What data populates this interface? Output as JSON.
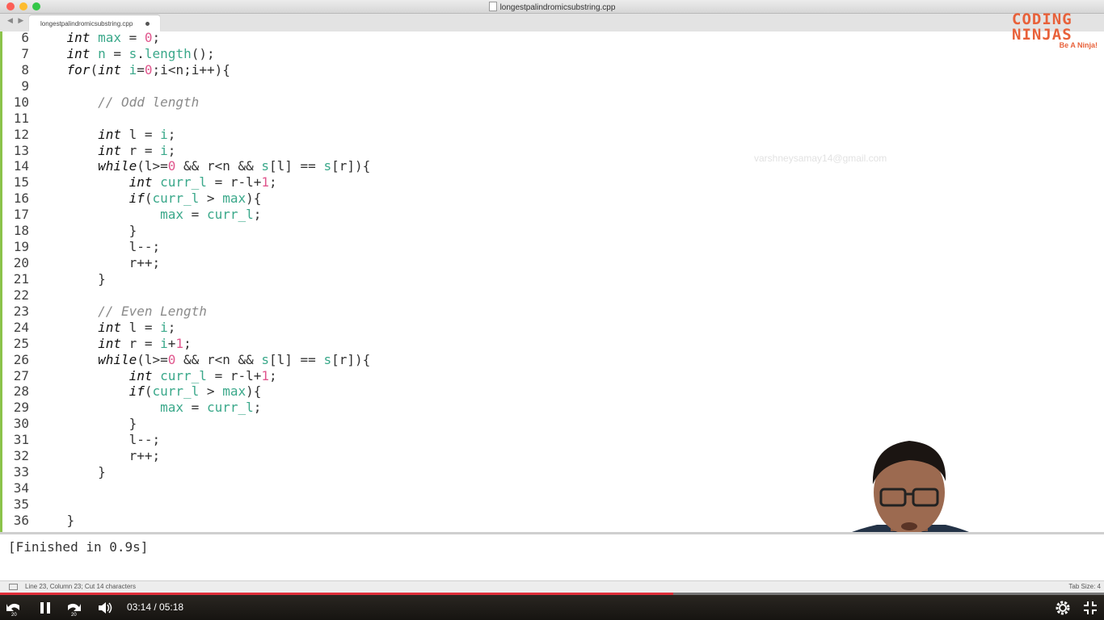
{
  "window": {
    "title": "longestpalindromicsubstring.cpp"
  },
  "tab": {
    "label": "longestpalindromicsubstring.cpp",
    "modified": true
  },
  "brand": {
    "line1": "CODING",
    "line2": "NINJAS",
    "tagline": "Be A Ninja!",
    "accent": "#e8613a"
  },
  "watermark": "varshneysamay14@gmail.com",
  "code": [
    {
      "ln": "6",
      "indent": "    ",
      "tokens": [
        [
          "kw",
          "int"
        ],
        [
          "p",
          " "
        ],
        [
          "v",
          "max"
        ],
        [
          "p",
          " = "
        ],
        [
          "n",
          "0"
        ],
        [
          "p",
          ";"
        ]
      ]
    },
    {
      "ln": "7",
      "indent": "    ",
      "tokens": [
        [
          "kw",
          "int"
        ],
        [
          "p",
          " "
        ],
        [
          "v",
          "n"
        ],
        [
          "p",
          " = "
        ],
        [
          "v",
          "s"
        ],
        [
          "p",
          "."
        ],
        [
          "v",
          "length"
        ],
        [
          "p",
          "();"
        ]
      ]
    },
    {
      "ln": "8",
      "indent": "    ",
      "tokens": [
        [
          "kw",
          "for"
        ],
        [
          "p",
          "("
        ],
        [
          "kw",
          "int"
        ],
        [
          "p",
          " "
        ],
        [
          "v",
          "i"
        ],
        [
          "p",
          "="
        ],
        [
          "n",
          "0"
        ],
        [
          "p",
          ";i<n;i++){"
        ]
      ]
    },
    {
      "ln": "9",
      "indent": "",
      "tokens": []
    },
    {
      "ln": "10",
      "indent": "        ",
      "tokens": [
        [
          "c",
          "// Odd length"
        ]
      ]
    },
    {
      "ln": "11",
      "indent": "",
      "tokens": []
    },
    {
      "ln": "12",
      "indent": "        ",
      "tokens": [
        [
          "kw",
          "int"
        ],
        [
          "p",
          " l = "
        ],
        [
          "v",
          "i"
        ],
        [
          "p",
          ";"
        ]
      ]
    },
    {
      "ln": "13",
      "indent": "        ",
      "tokens": [
        [
          "kw",
          "int"
        ],
        [
          "p",
          " r = "
        ],
        [
          "v",
          "i"
        ],
        [
          "p",
          ";"
        ]
      ]
    },
    {
      "ln": "14",
      "indent": "        ",
      "tokens": [
        [
          "kw",
          "while"
        ],
        [
          "p",
          "(l>="
        ],
        [
          "n",
          "0"
        ],
        [
          "p",
          " && r<n && "
        ],
        [
          "v",
          "s"
        ],
        [
          "p",
          "[l] == "
        ],
        [
          "v",
          "s"
        ],
        [
          "p",
          "[r]){"
        ]
      ]
    },
    {
      "ln": "15",
      "indent": "            ",
      "tokens": [
        [
          "kw",
          "int"
        ],
        [
          "p",
          " "
        ],
        [
          "v",
          "curr_l"
        ],
        [
          "p",
          " = r-l+"
        ],
        [
          "n",
          "1"
        ],
        [
          "p",
          ";"
        ]
      ]
    },
    {
      "ln": "16",
      "indent": "            ",
      "tokens": [
        [
          "kw",
          "if"
        ],
        [
          "p",
          "("
        ],
        [
          "v",
          "curr_l"
        ],
        [
          "p",
          " > "
        ],
        [
          "v",
          "max"
        ],
        [
          "p",
          "){"
        ]
      ]
    },
    {
      "ln": "17",
      "indent": "                ",
      "tokens": [
        [
          "v",
          "max"
        ],
        [
          "p",
          " = "
        ],
        [
          "v",
          "curr_l"
        ],
        [
          "p",
          ";"
        ]
      ]
    },
    {
      "ln": "18",
      "indent": "            ",
      "tokens": [
        [
          "p",
          "}"
        ]
      ]
    },
    {
      "ln": "19",
      "indent": "            ",
      "tokens": [
        [
          "p",
          "l--;"
        ]
      ]
    },
    {
      "ln": "20",
      "indent": "            ",
      "tokens": [
        [
          "p",
          "r++;"
        ]
      ]
    },
    {
      "ln": "21",
      "indent": "        ",
      "tokens": [
        [
          "p",
          "}"
        ]
      ]
    },
    {
      "ln": "22",
      "indent": "",
      "tokens": []
    },
    {
      "ln": "23",
      "indent": "        ",
      "tokens": [
        [
          "c",
          "// Even Length"
        ]
      ]
    },
    {
      "ln": "24",
      "indent": "        ",
      "tokens": [
        [
          "kw",
          "int"
        ],
        [
          "p",
          " l = "
        ],
        [
          "v",
          "i"
        ],
        [
          "p",
          ";"
        ]
      ]
    },
    {
      "ln": "25",
      "indent": "        ",
      "tokens": [
        [
          "kw",
          "int"
        ],
        [
          "p",
          " r = "
        ],
        [
          "v",
          "i"
        ],
        [
          "p",
          "+"
        ],
        [
          "n",
          "1"
        ],
        [
          "p",
          ";"
        ]
      ]
    },
    {
      "ln": "26",
      "indent": "        ",
      "tokens": [
        [
          "kw",
          "while"
        ],
        [
          "p",
          "(l>="
        ],
        [
          "n",
          "0"
        ],
        [
          "p",
          " && r<n && "
        ],
        [
          "v",
          "s"
        ],
        [
          "p",
          "[l] == "
        ],
        [
          "v",
          "s"
        ],
        [
          "p",
          "[r]){"
        ]
      ]
    },
    {
      "ln": "27",
      "indent": "            ",
      "tokens": [
        [
          "kw",
          "int"
        ],
        [
          "p",
          " "
        ],
        [
          "v",
          "curr_l"
        ],
        [
          "p",
          " = r-l+"
        ],
        [
          "n",
          "1"
        ],
        [
          "p",
          ";"
        ]
      ]
    },
    {
      "ln": "28",
      "indent": "            ",
      "tokens": [
        [
          "kw",
          "if"
        ],
        [
          "p",
          "("
        ],
        [
          "v",
          "curr_l"
        ],
        [
          "p",
          " > "
        ],
        [
          "v",
          "max"
        ],
        [
          "p",
          "){"
        ]
      ]
    },
    {
      "ln": "29",
      "indent": "                ",
      "tokens": [
        [
          "v",
          "max"
        ],
        [
          "p",
          " = "
        ],
        [
          "v",
          "curr_l"
        ],
        [
          "p",
          ";"
        ]
      ]
    },
    {
      "ln": "30",
      "indent": "            ",
      "tokens": [
        [
          "p",
          "}"
        ]
      ]
    },
    {
      "ln": "31",
      "indent": "            ",
      "tokens": [
        [
          "p",
          "l--;"
        ]
      ]
    },
    {
      "ln": "32",
      "indent": "            ",
      "tokens": [
        [
          "p",
          "r++;"
        ]
      ]
    },
    {
      "ln": "33",
      "indent": "        ",
      "tokens": [
        [
          "p",
          "}"
        ]
      ]
    },
    {
      "ln": "34",
      "indent": "",
      "tokens": []
    },
    {
      "ln": "35",
      "indent": "",
      "tokens": []
    },
    {
      "ln": "36",
      "indent": "    ",
      "tokens": [
        [
          "p",
          "}"
        ]
      ]
    }
  ],
  "console": {
    "output": "[Finished in 0.9s]"
  },
  "status": {
    "text": "Line 23, Column 23; Cut 14 characters",
    "tab_size": "Tab Size: 4"
  },
  "player": {
    "time": "03:14 / 05:18",
    "progress_fraction": 0.61,
    "skip_back": "20",
    "skip_forward": "20",
    "progress_color": "#e02f3a"
  }
}
